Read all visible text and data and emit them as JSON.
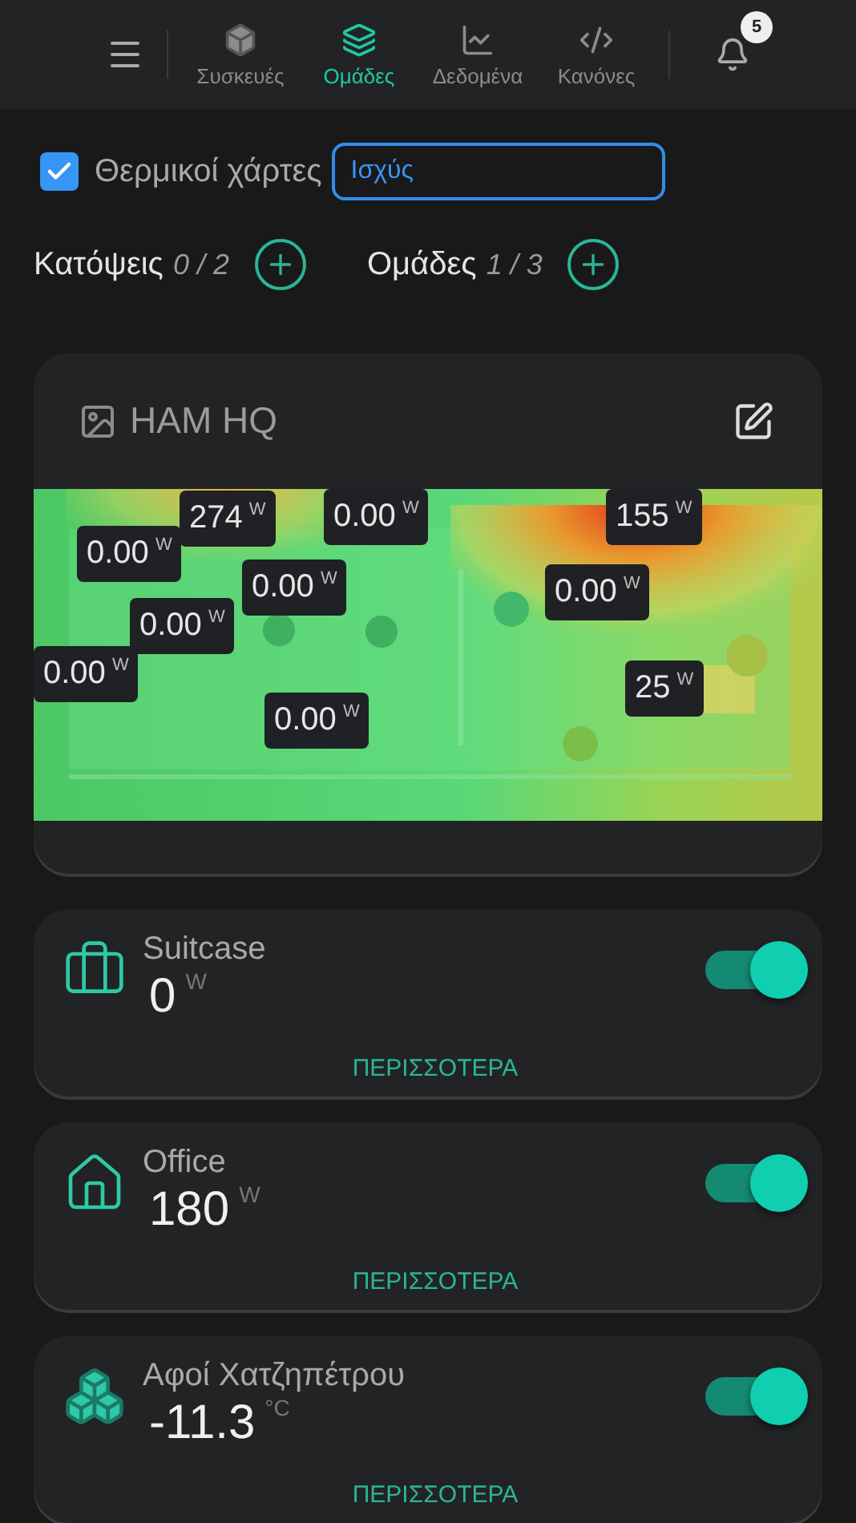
{
  "nav": {
    "items": [
      {
        "kind": "devices",
        "label": "Συσκευές",
        "selected": false
      },
      {
        "kind": "groups",
        "label": "Ομάδες",
        "selected": true
      },
      {
        "kind": "data",
        "label": "Δεδομένα",
        "selected": false
      },
      {
        "kind": "rules",
        "label": "Κανόνες",
        "selected": false
      }
    ],
    "notifications": "5"
  },
  "heatmap_toggle": {
    "label": "Θερμικοί χάρτες",
    "checked": true,
    "value": "Ισχύς"
  },
  "counters": [
    {
      "label": "Κατόψεις",
      "count": "0 / 2"
    },
    {
      "label": "Ομάδες",
      "count": "1 / 3"
    }
  ],
  "floorplan": {
    "title": "HAM HQ",
    "kind": "picture",
    "sensors": [
      {
        "value": "274",
        "unit": "W"
      },
      {
        "value": "0.00",
        "unit": "W"
      },
      {
        "value": "155",
        "unit": "W"
      },
      {
        "value": "0.00",
        "unit": "W"
      },
      {
        "value": "0.00",
        "unit": "W"
      },
      {
        "value": "0.00",
        "unit": "W"
      },
      {
        "value": "0.00",
        "unit": "W"
      },
      {
        "value": "0.00",
        "unit": "W"
      },
      {
        "value": "0.00",
        "unit": "W"
      },
      {
        "value": "25",
        "unit": "W"
      }
    ]
  },
  "groups": [
    {
      "kind": "suitcase",
      "name": "Suitcase",
      "value": "0",
      "unit": "W",
      "on": true,
      "more": "ΠΕΡΙΣΣΟΤΕΡΑ"
    },
    {
      "kind": "house",
      "name": "Office",
      "value": "180",
      "unit": "W",
      "on": true,
      "more": "ΠΕΡΙΣΣΟΤΕΡΑ"
    },
    {
      "kind": "cubes",
      "name": "Αφοί Χατζηπέτρου",
      "value": "-11.3",
      "unit": "°C",
      "on": true,
      "more": "ΠΕΡΙΣΣΟΤΕΡΑ"
    }
  ]
}
